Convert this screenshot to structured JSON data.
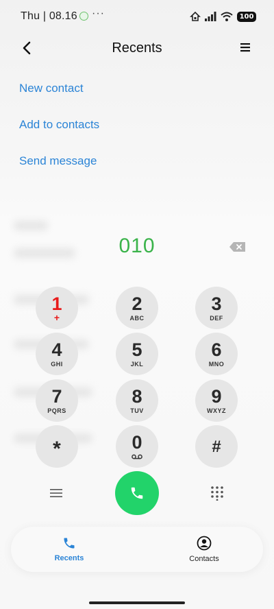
{
  "status_bar": {
    "time": "Thu | 08.16",
    "more_indicator": "···",
    "battery": "100"
  },
  "header": {
    "title": "Recents"
  },
  "actions": [
    {
      "label": "New contact"
    },
    {
      "label": "Add to contacts"
    },
    {
      "label": "Send message"
    }
  ],
  "dialer": {
    "number": "010"
  },
  "keypad": [
    {
      "digit": "1",
      "sub": "+"
    },
    {
      "digit": "2",
      "sub": "ABC"
    },
    {
      "digit": "3",
      "sub": "DEF"
    },
    {
      "digit": "4",
      "sub": "GHI"
    },
    {
      "digit": "5",
      "sub": "JKL"
    },
    {
      "digit": "6",
      "sub": "MNO"
    },
    {
      "digit": "7",
      "sub": "PQRS"
    },
    {
      "digit": "8",
      "sub": "TUV"
    },
    {
      "digit": "9",
      "sub": "WXYZ"
    },
    {
      "digit": "*",
      "sub": ""
    },
    {
      "digit": "0",
      "sub": ""
    },
    {
      "digit": "#",
      "sub": ""
    }
  ],
  "bottom_nav": {
    "recents": "Recents",
    "contacts": "Contacts"
  },
  "colors": {
    "accent_blue": "#2b84d6",
    "dial_number_green": "#3ab34a",
    "call_button_green": "#22d36a",
    "key_one_red": "#e81b1b"
  },
  "icons": {
    "back": "back-arrow-icon",
    "menu": "hamburger-menu-icon",
    "backspace": "backspace-icon",
    "voicemail": "voicemail-icon",
    "call": "phone-icon",
    "keypad": "dialpad-icon",
    "recents": "phone-icon",
    "contacts": "person-circle-icon"
  }
}
